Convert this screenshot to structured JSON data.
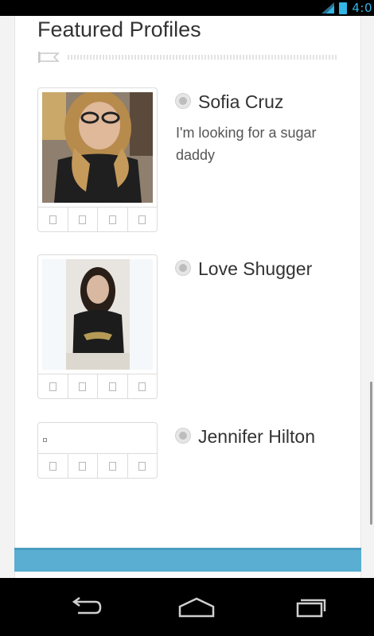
{
  "status_bar": {
    "time": "4:0",
    "accent_color": "#33b5e5",
    "icons": [
      "signal-icon",
      "battery-icon"
    ]
  },
  "section": {
    "title": "Featured Profiles",
    "title_icon": "flag-icon"
  },
  "profiles": [
    {
      "name": "Sofia Cruz",
      "bio": "I'm looking for a sugar daddy",
      "has_photo": true,
      "action_icons": [
        "action-1-icon",
        "action-2-icon",
        "action-3-icon",
        "action-4-icon"
      ]
    },
    {
      "name": "Love Shugger",
      "bio": "",
      "has_photo": true,
      "action_icons": [
        "action-1-icon",
        "action-2-icon",
        "action-3-icon",
        "action-4-icon"
      ]
    },
    {
      "name": "Jennifer Hilton",
      "bio": "",
      "has_photo": false,
      "action_icons": [
        "action-1-icon",
        "action-2-icon",
        "action-3-icon",
        "action-4-icon"
      ]
    }
  ],
  "bottom_bar": {
    "color": "#5aaed2"
  },
  "nav_bar": {
    "buttons": [
      "back-icon",
      "home-icon",
      "recent-apps-icon"
    ]
  }
}
